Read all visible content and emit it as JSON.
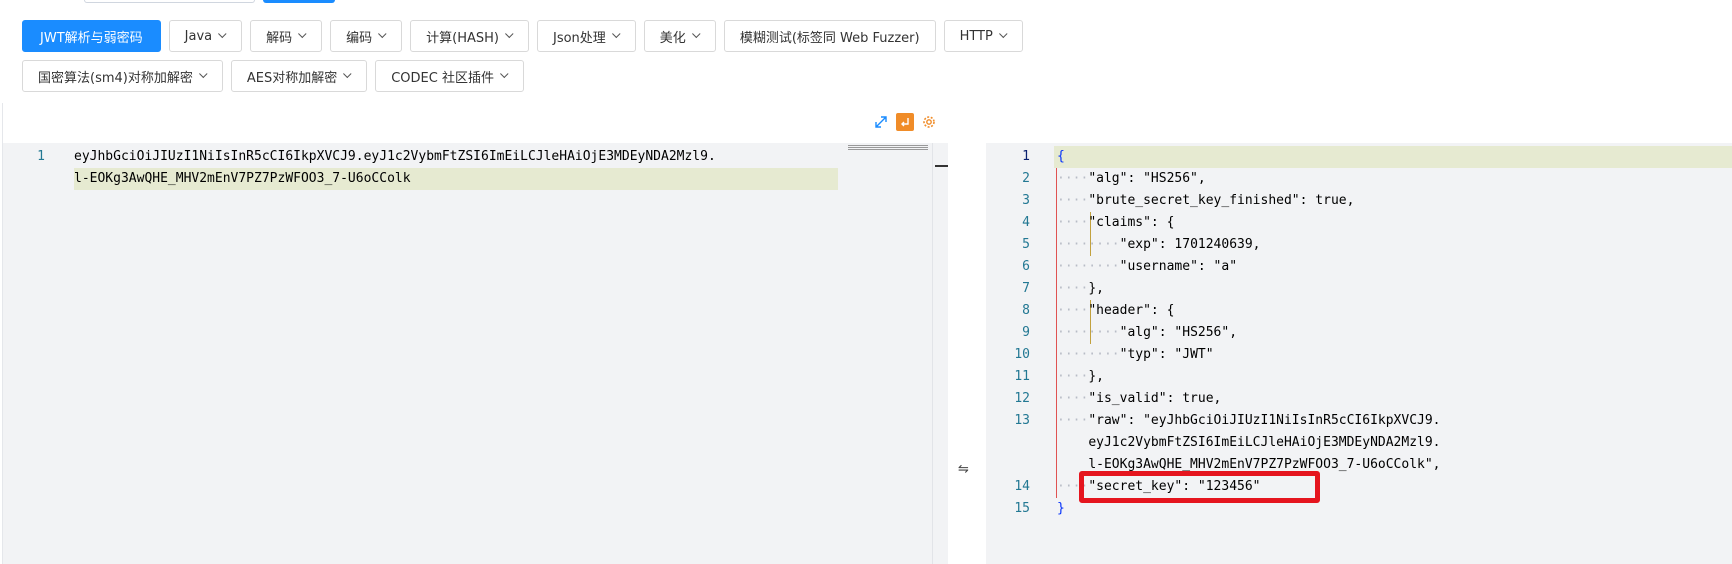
{
  "toolbar": {
    "row1": [
      {
        "label": "JWT解析与弱密码",
        "primary": true,
        "dropdown": false
      },
      {
        "label": "Java",
        "dropdown": true
      },
      {
        "label": "解码",
        "dropdown": true
      },
      {
        "label": "编码",
        "dropdown": true
      },
      {
        "label": "计算(HASH)",
        "dropdown": true
      },
      {
        "label": "Json处理",
        "dropdown": true
      },
      {
        "label": "美化",
        "dropdown": true
      },
      {
        "label": "模糊测试(标签同 Web Fuzzer)",
        "dropdown": false
      },
      {
        "label": "HTTP",
        "dropdown": true
      }
    ],
    "row2": [
      {
        "label": "国密算法(sm4)对称加解密",
        "dropdown": true
      },
      {
        "label": "AES对称加解密",
        "dropdown": true
      },
      {
        "label": "CODEC 社区插件",
        "dropdown": true
      }
    ]
  },
  "left_editor": {
    "line_number": "1",
    "segments": [
      "eyJhbGciOiJIUzI1NiIsInR5cCI6IkpXVCJ9.eyJ1c2VybmFtZSI6ImEiLCJleHAiOjE3MDEyNDA2Mzl9.",
      "l-EOKg3AwQHE_MHV2mEnV7PZ7PzWFOO3_7-U6oCColk"
    ]
  },
  "swap_icon": "⇋",
  "right_editor": {
    "line_numbers": [
      "1",
      "2",
      "3",
      "4",
      "5",
      "6",
      "7",
      "8",
      "9",
      "10",
      "11",
      "12",
      "13",
      "",
      "",
      "14",
      "15"
    ],
    "lines": [
      {
        "indent": "",
        "text": "{"
      },
      {
        "indent": "····",
        "text": "\"alg\": \"HS256\","
      },
      {
        "indent": "····",
        "text": "\"brute_secret_key_finished\": true,"
      },
      {
        "indent": "····",
        "text": "\"claims\": {"
      },
      {
        "indent": "········",
        "text": "\"exp\": 1701240639,"
      },
      {
        "indent": "········",
        "text": "\"username\": \"a\""
      },
      {
        "indent": "····",
        "text": "},"
      },
      {
        "indent": "····",
        "text": "\"header\": {"
      },
      {
        "indent": "········",
        "text": "\"alg\": \"HS256\","
      },
      {
        "indent": "········",
        "text": "\"typ\": \"JWT\""
      },
      {
        "indent": "····",
        "text": "},"
      },
      {
        "indent": "····",
        "text": "\"is_valid\": true,"
      },
      {
        "indent": "····",
        "text": "\"raw\": \"eyJhbGciOiJIUzI1NiIsInR5cCI6IkpXVCJ9."
      },
      {
        "indent": "    ",
        "text": "eyJ1c2VybmFtZSI6ImEiLCJleHAiOjE3MDEyNDA2Mzl9."
      },
      {
        "indent": "    ",
        "text": "l-EOKg3AwQHE_MHV2mEnV7PZ7PzWFOO3_7-U6oCColk\","
      },
      {
        "indent": "····",
        "text": "\"secret_key\": \"123456\""
      },
      {
        "indent": "",
        "text": "}"
      }
    ]
  },
  "colors": {
    "primary": "#1a8cff",
    "highlight": "#e6ead1",
    "annotation_box": "#e5151e",
    "line_number": "#237893"
  }
}
